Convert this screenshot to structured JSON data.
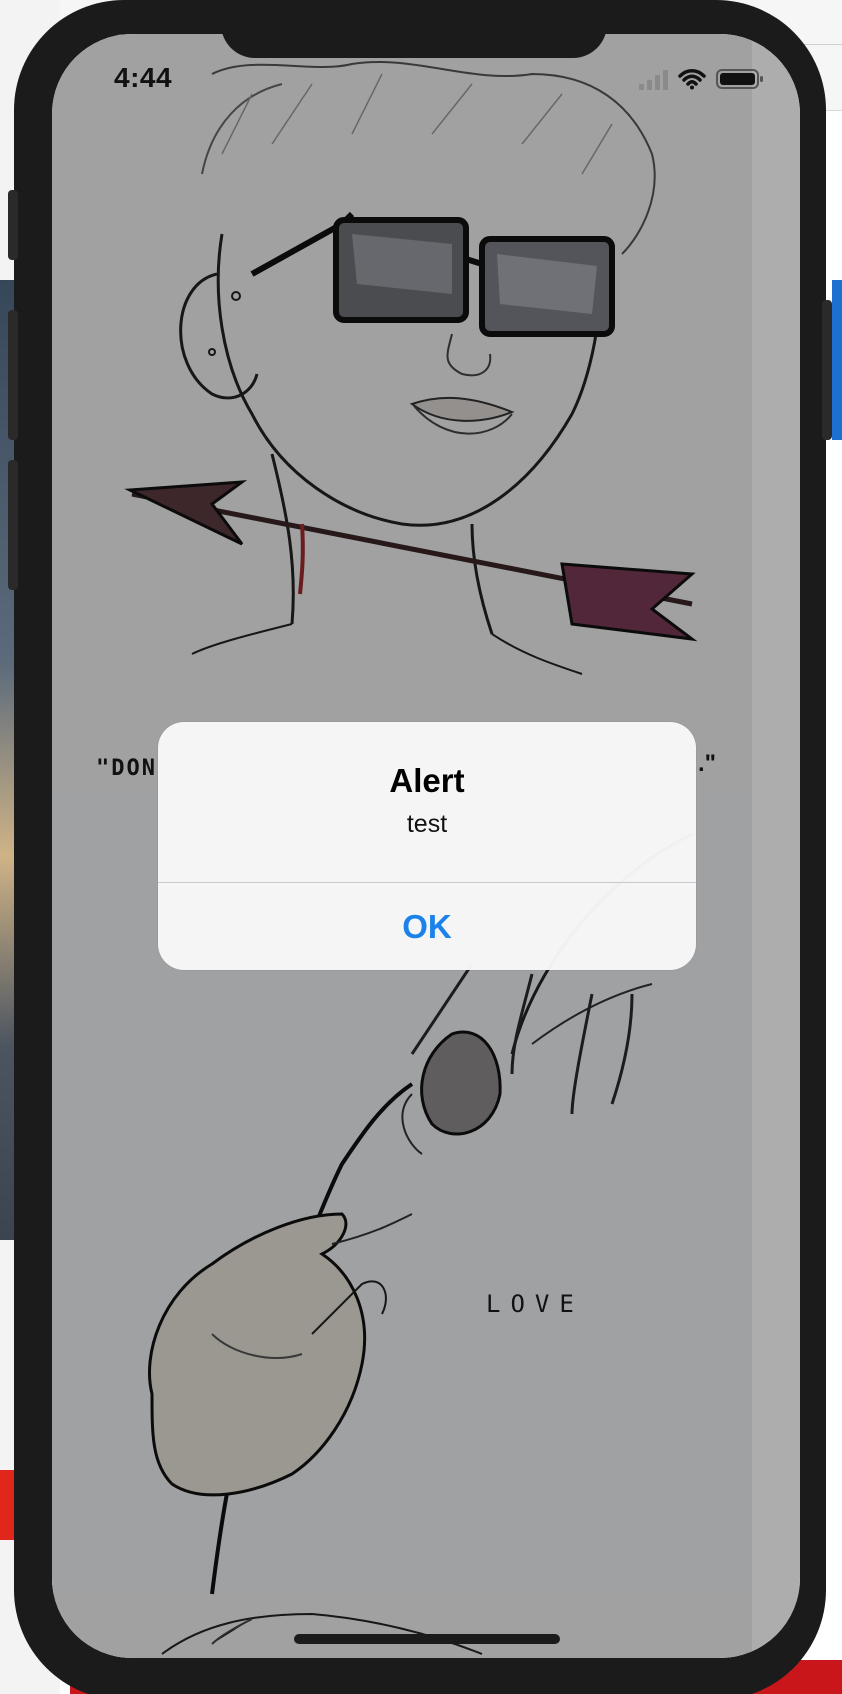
{
  "status_bar": {
    "time": "4:44"
  },
  "artwork": {
    "quote_start": "\"DON",
    "quote_end": ".\"",
    "love_caption": "LOVE"
  },
  "alert": {
    "title": "Alert",
    "message": "test",
    "ok_label": "OK"
  },
  "colors": {
    "alert_button": "#1a82ea",
    "phone_frame": "#1b1b1c",
    "alert_background": "#f8f8f8"
  },
  "icons": {
    "signal": "cellular-signal-icon",
    "wifi": "wifi-icon",
    "battery": "battery-icon"
  }
}
